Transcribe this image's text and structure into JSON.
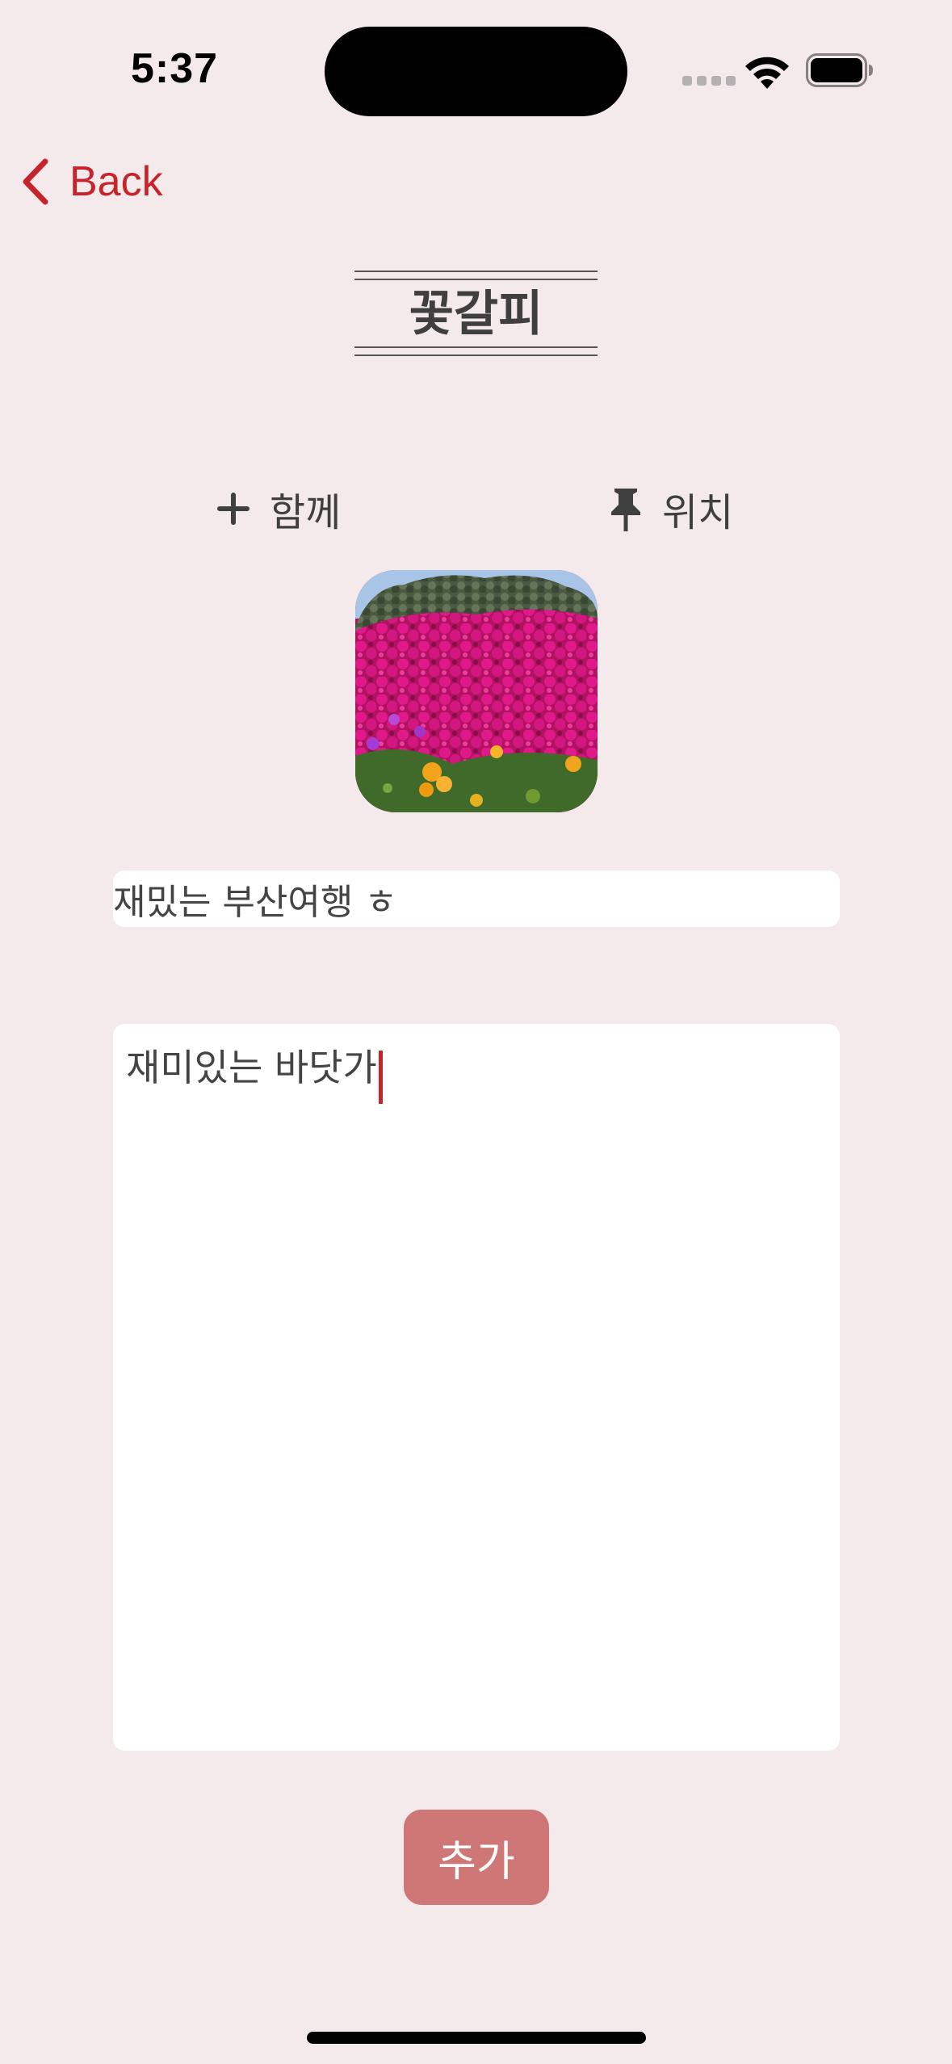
{
  "status_bar": {
    "time": "5:37",
    "icons": [
      "cellular-signal-icon",
      "wifi-icon",
      "battery-icon"
    ]
  },
  "nav": {
    "back_label": "Back",
    "back_icon": "chevron-left-icon"
  },
  "header": {
    "title": "꽃갈피"
  },
  "actions": {
    "together": {
      "icon": "plus-icon",
      "label": "함께"
    },
    "location": {
      "icon": "pin-icon",
      "label": "위치"
    }
  },
  "photo": {
    "subject": "pink flowers photo"
  },
  "form": {
    "title_value": "재밌는 부산여행 ㅎ",
    "memo_value": "재미있는 바닷가"
  },
  "submit": {
    "label": "추가"
  },
  "colors": {
    "background": "#f4eaeb",
    "accent": "#c4242a",
    "button": "#cf7776",
    "text": "#3f3f3f"
  }
}
